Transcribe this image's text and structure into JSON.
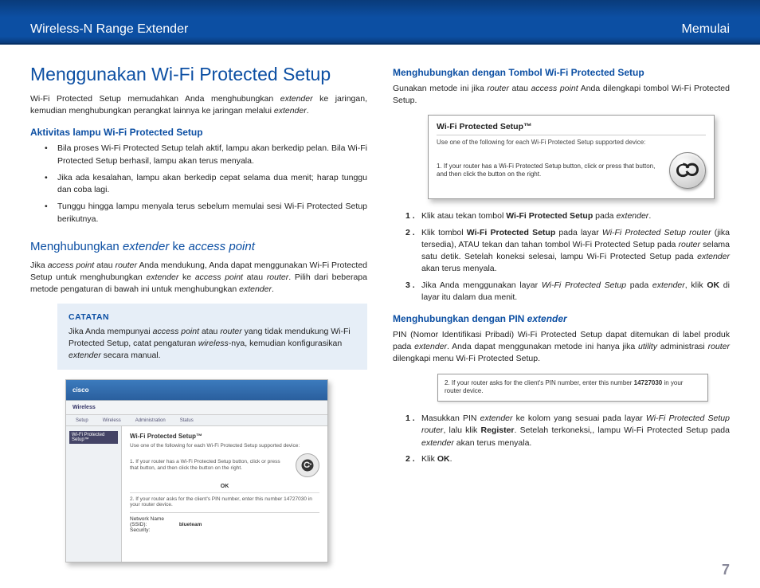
{
  "header": {
    "left": "Wireless-N Range Extender",
    "right": "Memulai"
  },
  "page_number": "7",
  "left": {
    "h1": "Menggunakan Wi-Fi Protected Setup",
    "intro_a": "Wi-Fi Protected Setup memudahkan Anda menghubungkan ",
    "intro_b": " ke jaringan, kemudian menghubungkan perangkat lainnya ke jaringan melalui ",
    "intro_it1": "extender",
    "intro_it2": "extender",
    "intro_end": ".",
    "h3a": "Aktivitas lampu Wi-Fi Protected Setup",
    "b1": "Bila proses Wi-Fi Protected Setup telah aktif, lampu akan berkedip pelan. Bila Wi-Fi Protected Setup berhasil, lampu akan terus menyala.",
    "b2": "Jika ada kesalahan, lampu akan berkedip cepat selama dua menit; harap tunggu dan coba lagi.",
    "b3": "Tunggu hingga lampu menyala terus sebelum memulai sesi Wi-Fi Protected Setup berikutnya.",
    "h2": "Menghubungkan ",
    "h2_it1": "extender",
    "h2_mid": " ke ",
    "h2_it2": "access point",
    "p2_a": "Jika ",
    "p2_it1": "access point",
    "p2_b": " atau ",
    "p2_it2": "router",
    "p2_c": " Anda mendukung, Anda dapat menggunakan Wi-Fi Protected Setup untuk menghubungkan ",
    "p2_it3": "extender",
    "p2_d": " ke ",
    "p2_it4": "access point",
    "p2_e": " atau ",
    "p2_it5": "router",
    "p2_f": ". Pilih dari beberapa metode pengaturan di bawah ini untuk menghubungkan ",
    "p2_it6": "extender",
    "p2_g": ".",
    "note_title": "CATATAN",
    "note_a": "Jika Anda mempunyai ",
    "note_it1": "access point",
    "note_b": " atau ",
    "note_it2": "router",
    "note_c": " yang tidak mendukung Wi-Fi Protected Setup, catat pengaturan ",
    "note_it3": "wireless",
    "note_d": "-nya, kemudian konfigurasikan ",
    "note_it4": "extender",
    "note_e": " secara manual.",
    "fig": {
      "brand": "cisco",
      "tab": "Wireless",
      "tabs": [
        "Setup",
        "Wireless",
        "Administration",
        "Status"
      ],
      "side": "Wi-Fi Protected Setup™",
      "title": "Wi-Fi Protected Setup™",
      "sub": "Use one of the following for each Wi-Fi Protected Setup supported device:",
      "row1": "1. If your router has a Wi-Fi Protected Setup button, click or press that button, and then click the button on the right.",
      "ok": "OK",
      "pin": "2. If your router asks for the client's PIN number, enter this number 14727030 in your router device.",
      "net_lbl1": "Network Name (SSID):",
      "net_val1": "blueteam",
      "net_lbl2": "Security:",
      "net_val2": ""
    }
  },
  "right": {
    "h3a": "Menghubungkan dengan Tombol Wi-Fi Protected Setup",
    "p1_a": "Gunakan metode ini jika ",
    "p1_it1": "router",
    "p1_b": " atau ",
    "p1_it2": "access point",
    "p1_c": " Anda dilengkapi tombol Wi-Fi Protected Setup.",
    "wps": {
      "title": "Wi-Fi Protected Setup™",
      "sub": "Use one of the following for each Wi-Fi Protected Setup supported device:",
      "row": "1. If your router has a Wi-Fi Protected Setup button, click or press that button, and then click the button on the right."
    },
    "s1_a": "Klik atau tekan tombol ",
    "s1_b": "Wi-Fi Protected Setup",
    "s1_c": " pada ",
    "s1_it": "extender",
    "s1_d": ".",
    "s2_a": "Klik tombol ",
    "s2_b": "Wi-Fi Protected Setup",
    "s2_c": " pada layar ",
    "s2_it1": "Wi-Fi Protected Setup router",
    "s2_d": " (jika tersedia), ATAU tekan dan tahan tombol Wi-Fi Protected Setup pada ",
    "s2_it2": "router",
    "s2_e": " selama satu detik. Setelah koneksi selesai, lampu Wi-Fi Protected Setup pada ",
    "s2_it3": "extender",
    "s2_f": " akan terus menyala.",
    "s3_a": "Jika Anda menggunakan layar ",
    "s3_it1": "Wi-Fi Protected Setup",
    "s3_b": " pada ",
    "s3_it2": "extender",
    "s3_c": ", klik ",
    "s3_bold": "OK",
    "s3_d": " di layar itu dalam dua menit.",
    "h3b": "Menghubungkan dengan PIN ",
    "h3b_it": "extender",
    "p2_a": "PIN (Nomor Identifikasi Pribadi) Wi-Fi Protected Setup dapat ditemukan di label produk pada ",
    "p2_it1": "extender",
    "p2_b": ". Anda dapat menggunakan metode ini hanya jika ",
    "p2_it2": "utility",
    "p2_c": " administrasi ",
    "p2_it3": "router",
    "p2_d": " dilengkapi menu Wi-Fi Protected Setup.",
    "pinbox_a": "2. If your router asks for the client's PIN number, enter this number ",
    "pinbox_b": "14727030",
    "pinbox_c": " in your router device.",
    "t1_a": "Masukkan PIN ",
    "t1_it1": "extender",
    "t1_b": " ke kolom yang sesuai pada layar ",
    "t1_it2": "Wi-Fi Protected Setup router",
    "t1_c": ", lalu klik ",
    "t1_bold": "Register",
    "t1_d": ". Setelah terkoneksi,, lampu Wi-Fi Protected Setup pada ",
    "t1_it3": "extender",
    "t1_e": " akan terus menyala.",
    "t2_a": "Klik ",
    "t2_bold": "OK",
    "t2_b": "."
  }
}
